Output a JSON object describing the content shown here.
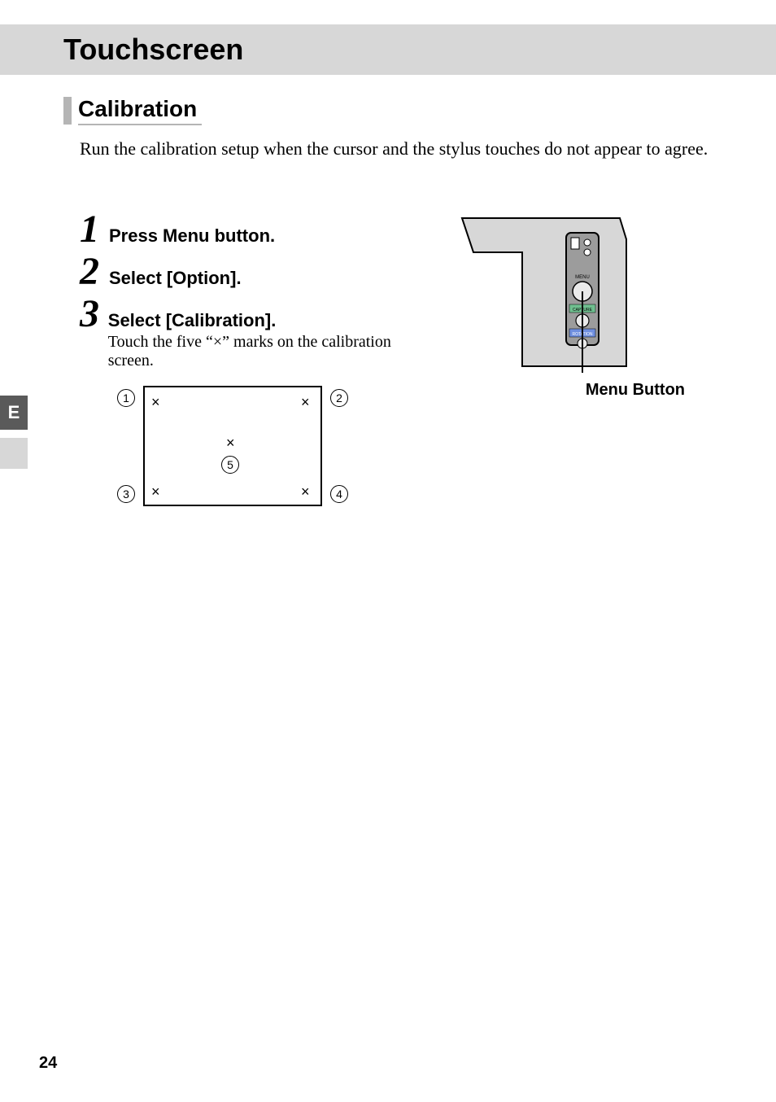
{
  "title": "Touchscreen",
  "section": "Calibration",
  "intro": "Run the calibration setup when the cursor and the stylus touches do not appear to agree.",
  "steps": [
    {
      "n": "1",
      "title": "Press Menu button.",
      "desc": ""
    },
    {
      "n": "2",
      "title": "Select [Option].",
      "desc": ""
    },
    {
      "n": "3",
      "title": "Select [Calibration].",
      "desc": "Touch the five “×” marks on the calibration screen."
    }
  ],
  "calib": {
    "marks": {
      "tl": "×",
      "tr": "×",
      "bl": "×",
      "br": "×",
      "c": "×"
    },
    "labels": {
      "c1": "1",
      "c2": "2",
      "c3": "3",
      "c4": "4",
      "c5": "5"
    }
  },
  "menu_button_label": "Menu Button",
  "side_tab": "E",
  "page_number": "24"
}
